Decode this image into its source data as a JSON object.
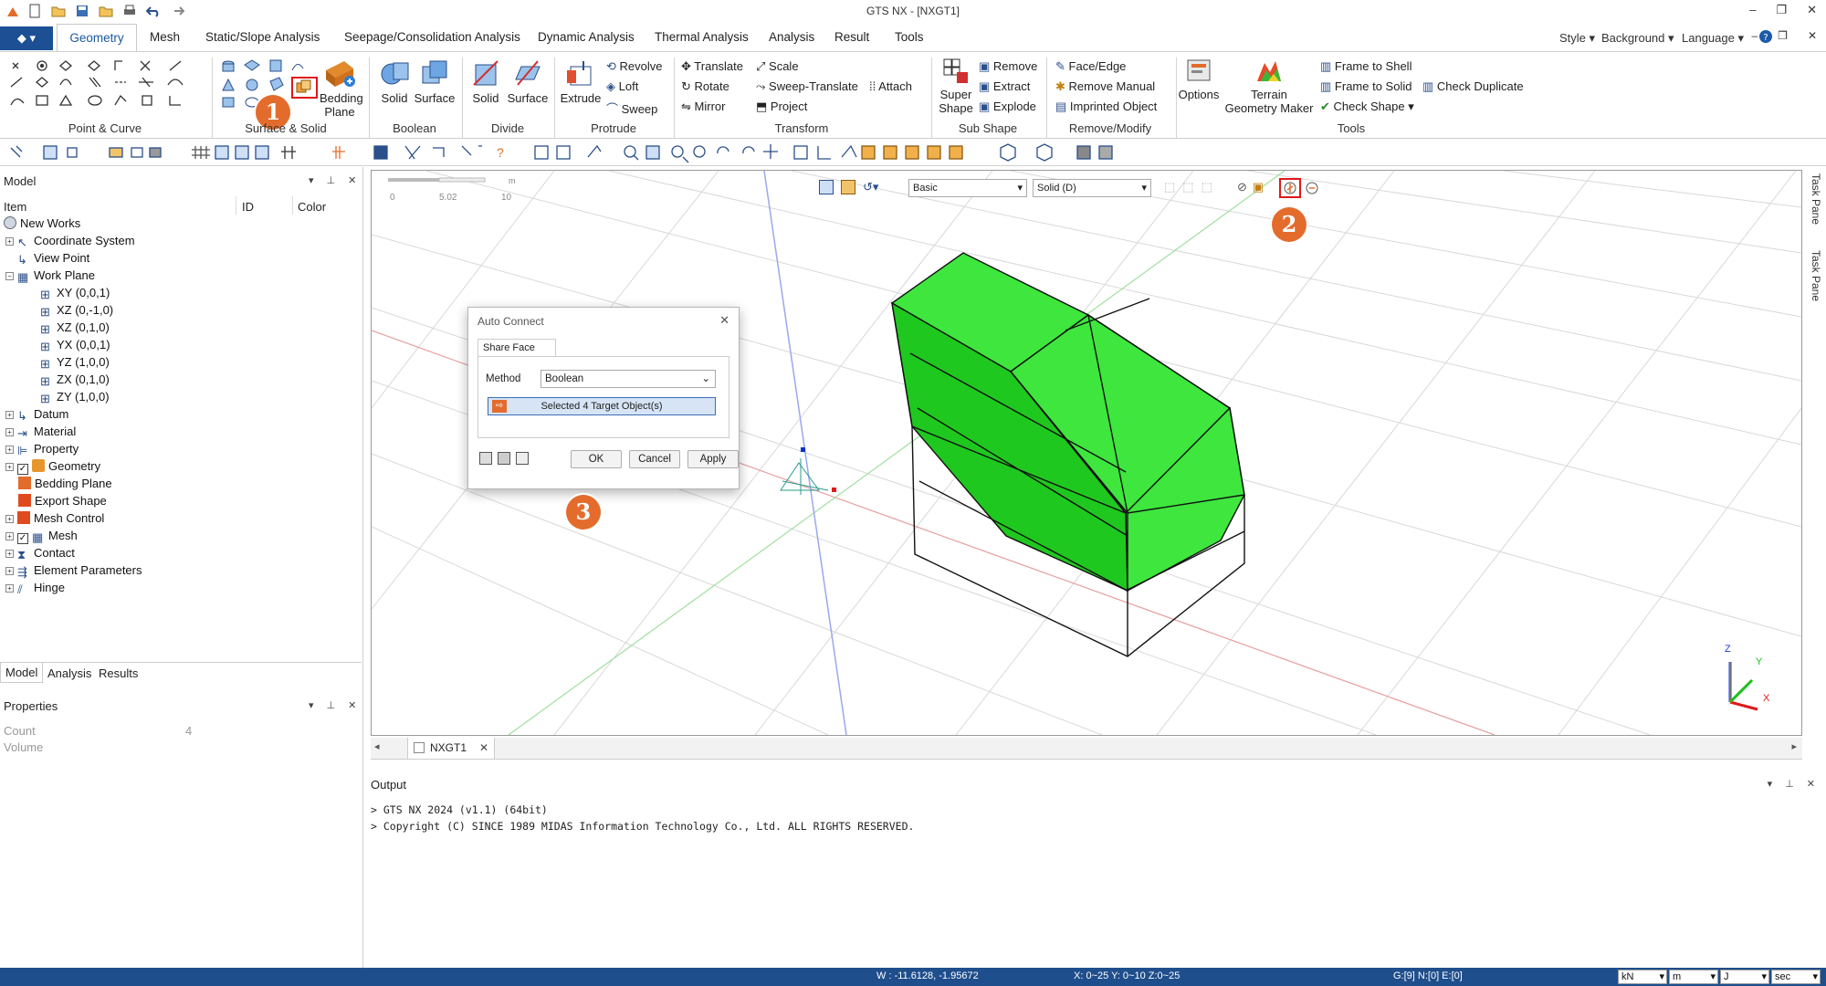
{
  "titlebar": {
    "title": "GTS NX - [NXGT1]"
  },
  "ribbon_tabs": [
    "Geometry",
    "Mesh",
    "Static/Slope Analysis",
    "Seepage/Consolidation Analysis",
    "Dynamic Analysis",
    "Thermal Analysis",
    "Analysis",
    "Result",
    "Tools"
  ],
  "right_menu": {
    "style": "Style",
    "background": "Background",
    "language": "Language"
  },
  "groups": {
    "point_curve": "Point & Curve",
    "surface_solid": "Surface & Solid",
    "boolean": "Boolean",
    "divide": "Divide",
    "protrude": "Protrude",
    "transform": "Transform",
    "sub_shape": "Sub Shape",
    "remove_modify": "Remove/Modify",
    "tools": "Tools"
  },
  "buttons": {
    "bedding_plane": "Bedding Plane",
    "boolean_solid": "Solid",
    "boolean_surface": "Surface",
    "divide_solid": "Solid",
    "divide_surface": "Surface",
    "extrude": "Extrude",
    "revolve": "Revolve",
    "loft": "Loft",
    "sweep": "Sweep",
    "translate": "Translate",
    "scale": "Scale",
    "rotate": "Rotate",
    "sweep_translate": "Sweep-Translate",
    "attach": "Attach",
    "mirror": "Mirror",
    "project": "Project",
    "super_shape": "Super Shape",
    "remove": "Remove",
    "extract": "Extract",
    "explode": "Explode",
    "face_edge": "Face/Edge",
    "remove_manual": "Remove Manual",
    "imprinted_object": "Imprinted Object",
    "options": "Options",
    "terrain_geometry_maker": "Terrain Geometry Maker",
    "frame_to_shell": "Frame to Shell",
    "frame_to_solid": "Frame to Solid",
    "check_duplicate": "Check Duplicate",
    "check_shape": "Check Shape"
  },
  "model_pane": {
    "title": "Model",
    "columns": [
      "Item",
      "ID",
      "Color"
    ],
    "tree": [
      {
        "label": "New Works",
        "level": 0
      },
      {
        "label": "Coordinate System",
        "level": 1
      },
      {
        "label": "View Point",
        "level": 1
      },
      {
        "label": "Work Plane",
        "level": 1
      },
      {
        "label": "XY (0,0,1)",
        "level": 2
      },
      {
        "label": "XZ (0,-1,0)",
        "level": 2
      },
      {
        "label": "XZ (0,1,0)",
        "level": 2
      },
      {
        "label": "YX (0,0,1)",
        "level": 2
      },
      {
        "label": "YZ (1,0,0)",
        "level": 2
      },
      {
        "label": "ZX (0,1,0)",
        "level": 2
      },
      {
        "label": "ZY (1,0,0)",
        "level": 2
      },
      {
        "label": "Datum",
        "level": 1
      },
      {
        "label": "Material",
        "level": 1
      },
      {
        "label": "Property",
        "level": 1
      },
      {
        "label": "Geometry",
        "level": 1
      },
      {
        "label": "Bedding Plane",
        "level": 1
      },
      {
        "label": "Export Shape",
        "level": 1
      },
      {
        "label": "Mesh Control",
        "level": 1
      },
      {
        "label": "Mesh",
        "level": 1
      },
      {
        "label": "Contact",
        "level": 1
      },
      {
        "label": "Element Parameters",
        "level": 1
      },
      {
        "label": "Hinge",
        "level": 1
      }
    ],
    "bottom_tabs": [
      "Model",
      "Analysis",
      "Results"
    ]
  },
  "properties_pane": {
    "title": "Properties",
    "count_label": "Count",
    "count_value": "4",
    "volume_label": "Volume"
  },
  "viewport": {
    "view_mode": "Basic",
    "display_mode": "Solid (D)",
    "scale_labels": [
      "0",
      "5.02",
      "10"
    ],
    "scale_unit": "m",
    "axis": {
      "x": "X",
      "y": "Y",
      "z": "Z"
    },
    "solid_color": "#3ee63e",
    "solid_color_dark": "#1fc81f"
  },
  "doc_tab": "NXGT1",
  "dialog": {
    "title": "Auto Connect",
    "tab": "Share Face",
    "method_label": "Method",
    "method_value": "Boolean",
    "target_label": "Selected 4 Target Object(s)",
    "ok": "OK",
    "cancel": "Cancel",
    "apply": "Apply"
  },
  "badges": [
    "1",
    "2",
    "3"
  ],
  "side_tabs": [
    "Task Pane",
    "Task Pane"
  ],
  "output": {
    "title": "Output",
    "lines": [
      "> GTS NX 2024 (v1.1) (64bit)",
      "> Copyright (C) SINCE 1989 MIDAS Information Technology Co., Ltd. ALL RIGHTS RESERVED."
    ]
  },
  "status": {
    "w": "W : -11.6128, -1.95672",
    "range": "X: 0~25 Y: 0~10 Z:0~25",
    "g": "G:[9] N:[0] E:[0]",
    "units": [
      "kN",
      "m",
      "J",
      "sec"
    ]
  }
}
